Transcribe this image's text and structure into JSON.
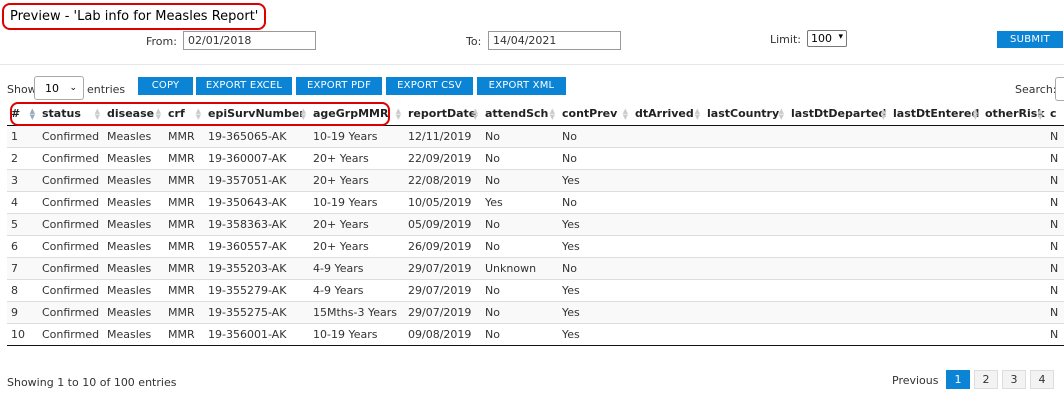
{
  "header": {
    "title": "Preview - 'Lab info for Measles Report'"
  },
  "filters": {
    "from_label": "From:",
    "from_value": "02/01/2018",
    "to_label": "To:",
    "to_value": "14/04/2021",
    "limit_label": "Limit:",
    "limit_value": "100",
    "submit_label": "SUBMIT"
  },
  "toolbar": {
    "show_label": "Show",
    "entries_value": "10",
    "entries_label": "entries",
    "copy": "COPY",
    "export_excel": "EXPORT EXCEL",
    "export_pdf": "EXPORT PDF",
    "export_csv": "EXPORT CSV",
    "export_xml": "EXPORT XML",
    "search_label": "Search:"
  },
  "table": {
    "columns": [
      "#",
      "status",
      "disease",
      "crf",
      "epiSurvNumber",
      "ageGrpMMR",
      "reportDate",
      "attendSch",
      "contPrev",
      "dtArrived",
      "lastCountry",
      "lastDtDeparted",
      "lastDtEntered",
      "otherRisk",
      "c"
    ],
    "rows": [
      [
        "1",
        "Confirmed",
        "Measles",
        "MMR",
        "19-365065-AK",
        "10-19 Years",
        "12/11/2019",
        "No",
        "No",
        "",
        "",
        "",
        "",
        "",
        "N"
      ],
      [
        "2",
        "Confirmed",
        "Measles",
        "MMR",
        "19-360007-AK",
        "20+ Years",
        "22/09/2019",
        "No",
        "No",
        "",
        "",
        "",
        "",
        "",
        "N"
      ],
      [
        "3",
        "Confirmed",
        "Measles",
        "MMR",
        "19-357051-AK",
        "20+ Years",
        "22/08/2019",
        "No",
        "Yes",
        "",
        "",
        "",
        "",
        "",
        "N"
      ],
      [
        "4",
        "Confirmed",
        "Measles",
        "MMR",
        "19-350643-AK",
        "10-19 Years",
        "10/05/2019",
        "Yes",
        "No",
        "",
        "",
        "",
        "",
        "",
        "N"
      ],
      [
        "5",
        "Confirmed",
        "Measles",
        "MMR",
        "19-358363-AK",
        "20+ Years",
        "05/09/2019",
        "No",
        "Yes",
        "",
        "",
        "",
        "",
        "",
        "N"
      ],
      [
        "6",
        "Confirmed",
        "Measles",
        "MMR",
        "19-360557-AK",
        "20+ Years",
        "26/09/2019",
        "No",
        "Yes",
        "",
        "",
        "",
        "",
        "",
        "N"
      ],
      [
        "7",
        "Confirmed",
        "Measles",
        "MMR",
        "19-355203-AK",
        "4-9 Years",
        "29/07/2019",
        "Unknown",
        "No",
        "",
        "",
        "",
        "",
        "",
        "N"
      ],
      [
        "8",
        "Confirmed",
        "Measles",
        "MMR",
        "19-355279-AK",
        "4-9 Years",
        "29/07/2019",
        "No",
        "Yes",
        "",
        "",
        "",
        "",
        "",
        "N"
      ],
      [
        "9",
        "Confirmed",
        "Measles",
        "MMR",
        "19-355275-AK",
        "15Mths-3 Years",
        "29/07/2019",
        "No",
        "Yes",
        "",
        "",
        "",
        "",
        "",
        "N"
      ],
      [
        "10",
        "Confirmed",
        "Measles",
        "MMR",
        "19-356001-AK",
        "10-19 Years",
        "09/08/2019",
        "No",
        "Yes",
        "",
        "",
        "",
        "",
        "",
        "N"
      ]
    ]
  },
  "footer": {
    "info": "Showing 1 to 10 of 100 entries",
    "previous": "Previous",
    "pages": [
      "1",
      "2",
      "3",
      "4"
    ]
  },
  "colors": {
    "accent": "#0b84d6",
    "highlight": "#dd0000"
  }
}
